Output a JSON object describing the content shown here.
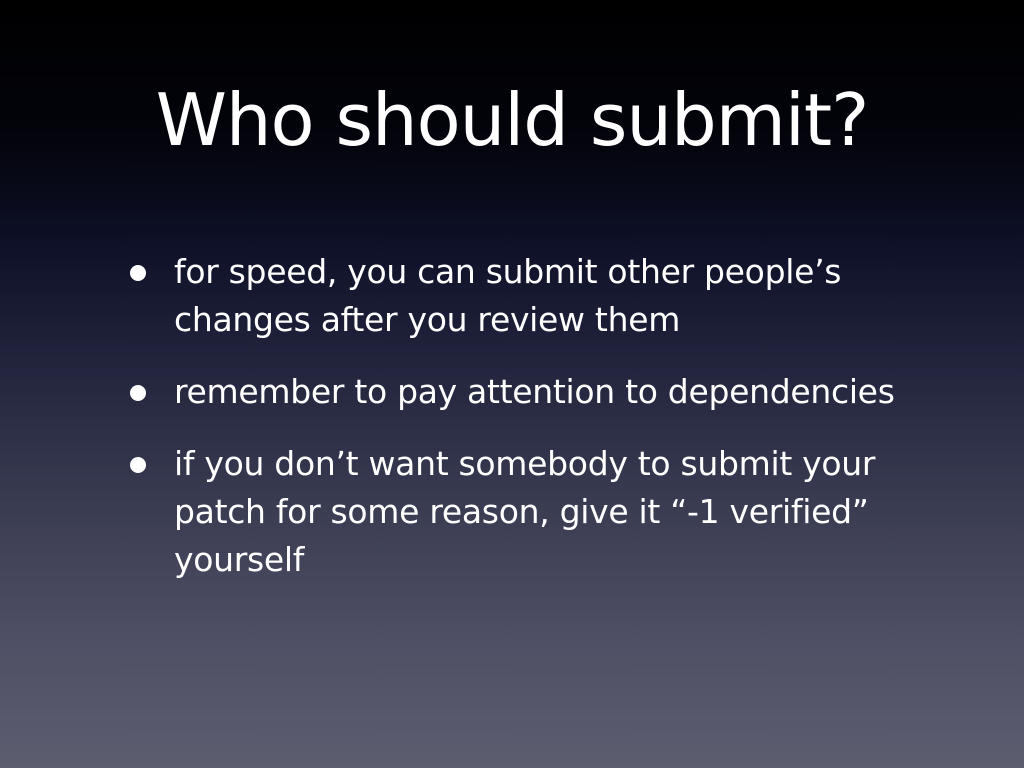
{
  "slide": {
    "title": "Who should submit?",
    "bullets": [
      "for speed, you can submit other people’s changes after you review them",
      "remember to pay attention to dependencies",
      "if you don’t want somebody to submit your patch for some reason, give it “-1 verified” yourself"
    ]
  },
  "colors": {
    "text": "#ffffff",
    "background_top": "#000000",
    "background_bottom": "#5d5d70"
  }
}
